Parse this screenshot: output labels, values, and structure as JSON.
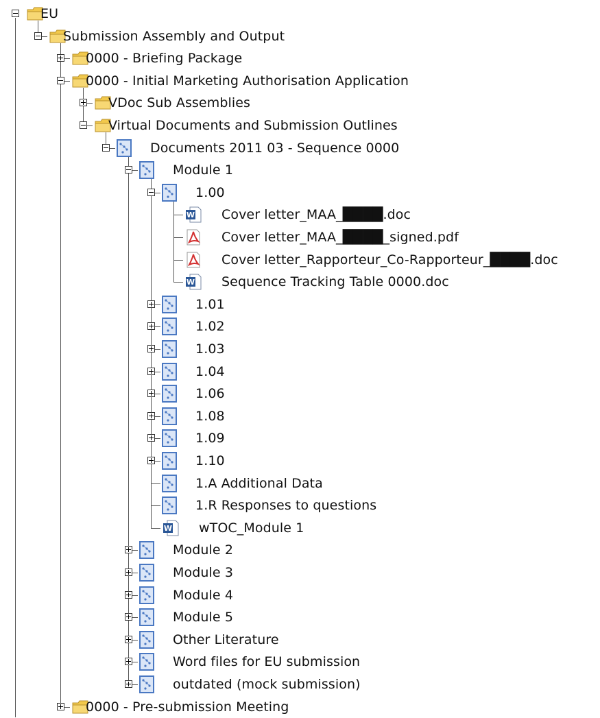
{
  "tree": {
    "nodes": [
      {
        "label": "EU",
        "level": 0,
        "icon": "folder-icon",
        "toggle": "minus"
      },
      {
        "label": "Submission Assembly and Output",
        "level": 1,
        "icon": "folder-icon",
        "toggle": "minus"
      },
      {
        "label": "0000 - Briefing Package",
        "level": 2,
        "icon": "folder-icon",
        "toggle": "plus"
      },
      {
        "label": "0000 - Initial Marketing Authorisation Application",
        "level": 2,
        "icon": "folder-icon",
        "toggle": "minus"
      },
      {
        "label": "VDoc Sub Assemblies",
        "level": 3,
        "icon": "folder-icon",
        "toggle": "plus"
      },
      {
        "label": "Virtual Documents and Submission Outlines",
        "level": 3,
        "icon": "folder-icon",
        "toggle": "minus"
      },
      {
        "label": "Documents 2011 03 - Sequence 0000",
        "level": 4,
        "icon": "virtual-document-icon",
        "toggle": "minus"
      },
      {
        "label": "Module 1",
        "level": 5,
        "icon": "virtual-document-icon",
        "toggle": "minus"
      },
      {
        "label": "1.00",
        "level": 6,
        "icon": "virtual-document-icon",
        "toggle": "minus"
      },
      {
        "label": "Cover letter_MAA_████.doc",
        "level": 7,
        "icon": "word-document-icon",
        "toggle": ""
      },
      {
        "label": "Cover letter_MAA_████_signed.pdf",
        "level": 7,
        "icon": "pdf-document-icon",
        "toggle": ""
      },
      {
        "label": "Cover letter_Rapporteur_Co-Rapporteur_████.doc",
        "level": 7,
        "icon": "pdf-document-icon",
        "toggle": ""
      },
      {
        "label": "Sequence Tracking Table 0000.doc",
        "level": 7,
        "icon": "word-document-icon",
        "toggle": ""
      },
      {
        "label": "1.01",
        "level": 6,
        "icon": "virtual-document-icon",
        "toggle": "plus"
      },
      {
        "label": "1.02",
        "level": 6,
        "icon": "virtual-document-icon",
        "toggle": "plus"
      },
      {
        "label": "1.03",
        "level": 6,
        "icon": "virtual-document-icon",
        "toggle": "plus"
      },
      {
        "label": "1.04",
        "level": 6,
        "icon": "virtual-document-icon",
        "toggle": "plus"
      },
      {
        "label": "1.06",
        "level": 6,
        "icon": "virtual-document-icon",
        "toggle": "plus"
      },
      {
        "label": "1.08",
        "level": 6,
        "icon": "virtual-document-icon",
        "toggle": "plus"
      },
      {
        "label": "1.09",
        "level": 6,
        "icon": "virtual-document-icon",
        "toggle": "plus"
      },
      {
        "label": "1.10",
        "level": 6,
        "icon": "virtual-document-icon",
        "toggle": "plus"
      },
      {
        "label": "1.A Additional Data",
        "level": 6,
        "icon": "virtual-document-icon",
        "toggle": ""
      },
      {
        "label": "1.R Responses to questions",
        "level": 6,
        "icon": "virtual-document-icon",
        "toggle": ""
      },
      {
        "label": "wTOC_Module 1",
        "level": 6,
        "icon": "word-document-icon",
        "toggle": ""
      },
      {
        "label": "Module 2",
        "level": 5,
        "icon": "virtual-document-icon",
        "toggle": "plus"
      },
      {
        "label": "Module 3",
        "level": 5,
        "icon": "virtual-document-icon",
        "toggle": "plus"
      },
      {
        "label": "Module 4",
        "level": 5,
        "icon": "virtual-document-icon",
        "toggle": "plus"
      },
      {
        "label": "Module 5",
        "level": 5,
        "icon": "virtual-document-icon",
        "toggle": "plus"
      },
      {
        "label": "Other Literature",
        "level": 5,
        "icon": "virtual-document-icon",
        "toggle": "plus"
      },
      {
        "label": "Word files for EU submission",
        "level": 5,
        "icon": "virtual-document-icon",
        "toggle": "plus"
      },
      {
        "label": "outdated (mock submission)",
        "level": 5,
        "icon": "virtual-document-icon",
        "toggle": "plus"
      },
      {
        "label": "0000 - Pre-submission Meeting",
        "level": 2,
        "icon": "folder-icon",
        "toggle": "plus"
      }
    ]
  },
  "colors": {
    "folder": "#f2c94c",
    "vdoc": "#4a78c2",
    "word": "#2b5797",
    "pdf": "#d32f2f",
    "lines": "#555555"
  }
}
